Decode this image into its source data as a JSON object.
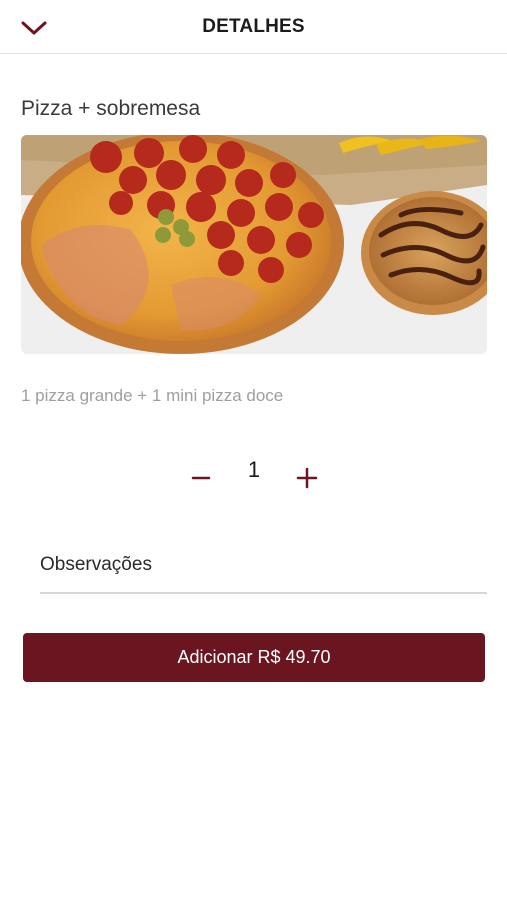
{
  "header": {
    "title": "DETALHES",
    "back_icon": "chevron-down-icon"
  },
  "product": {
    "title": "Pizza + sobremesa",
    "description": "1 pizza grande + 1 mini pizza doce",
    "image_icon": "pizza-photo"
  },
  "quantity": {
    "minus_label": "−",
    "value": "1",
    "plus_label": "+"
  },
  "observations": {
    "label": "Observações"
  },
  "add_button": {
    "label": "Adicionar R$ 49.70"
  },
  "colors": {
    "accent": "#6b1520",
    "text_muted": "#9e9e9e",
    "divider": "#e3e3e3"
  }
}
